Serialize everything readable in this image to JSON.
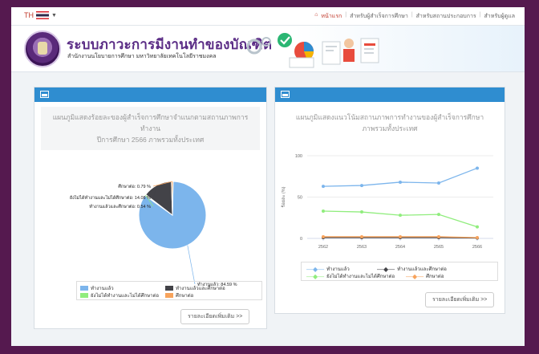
{
  "topbar": {
    "lang": "TH",
    "breadcrumbs": [
      "หน้าแรก",
      "สำหรับผู้สำเร็จการศึกษา",
      "สำหรับสถานประกอบการ",
      "สำหรับผู้ดูแล"
    ]
  },
  "header": {
    "title": "ระบบภาวะการมีงานทำของบัณฑิต",
    "subtitle": "สำนักงานนโยบายการศึกษา มหาวิทยาลัยเทคโนโลยีราชมงคล"
  },
  "left_panel": {
    "title_line1": "แผนภูมิแสดงร้อยละของผู้สำเร็จการศึกษาจำแนกตามสถานภาพการ",
    "title_line2": "ทำงาน",
    "title_line3": "ปีการศึกษา 2566 ภาพรวมทั้งประเทศ",
    "more_button": "รายละเอียดเพิ่มเติม >>",
    "chart_data": {
      "type": "pie",
      "labels": [
        "ทำงานแล้ว",
        "ยังไม่ได้ทำงานและไม่ได้ศึกษาต่อ",
        "ทำงานแล้วและศึกษาต่อ",
        "ศึกษาต่อ"
      ],
      "values": [
        84.59,
        14.08,
        0.54,
        0.79
      ],
      "slice_labels": [
        "ทำงานแล้ว: 84.59 %",
        "ยังไม่ได้ทำงานและไม่ได้ศึกษาต่อ: 14.08 %",
        "ทำงานแล้วและศึกษาต่อ: 0.54 %",
        "ศึกษาต่อ: 0.79 %"
      ],
      "colors": [
        "#7cb5ec",
        "#434348",
        "#90ed7d",
        "#f7a35c"
      ],
      "legend": [
        "ทำงานแล้ว",
        "ทำงานแล้วและศึกษาต่อ",
        "ยังไม่ได้ทำงานและไม่ได้ศึกษาต่อ",
        "ศึกษาต่อ"
      ],
      "legend_colors": [
        "#7cb5ec",
        "#434348",
        "#90ed7d",
        "#f7a35c"
      ]
    }
  },
  "right_panel": {
    "title_line1": "แผนภูมิแสดงแนวโน้มสถานภาพการทำงานของผู้สำเร็จการศึกษา",
    "title_line2": "ภาพรวมทั้งประเทศ",
    "more_button": "รายละเอียดเพิ่มเติม >>",
    "chart_data": {
      "type": "line",
      "x": [
        "2562",
        "2563",
        "2564",
        "2565",
        "2566"
      ],
      "ylim": [
        0,
        100
      ],
      "yticks": [
        "0",
        "50",
        "100"
      ],
      "ylabel": "ร้อยละ (%)",
      "series": [
        {
          "name": "ทำงานแล้ว",
          "color": "#7cb5ec",
          "values": [
            63,
            64,
            68,
            67,
            85
          ]
        },
        {
          "name": "ทำงานแล้วและศึกษาต่อ",
          "color": "#434348",
          "values": [
            1,
            1,
            1,
            1,
            0.5
          ]
        },
        {
          "name": "ยังไม่ได้ทำงานและไม่ได้ศึกษาต่อ",
          "color": "#90ed7d",
          "values": [
            33,
            32,
            28,
            29,
            14
          ]
        },
        {
          "name": "ศึกษาต่อ",
          "color": "#f7a35c",
          "values": [
            2,
            2,
            2,
            2,
            1
          ]
        }
      ]
    }
  }
}
